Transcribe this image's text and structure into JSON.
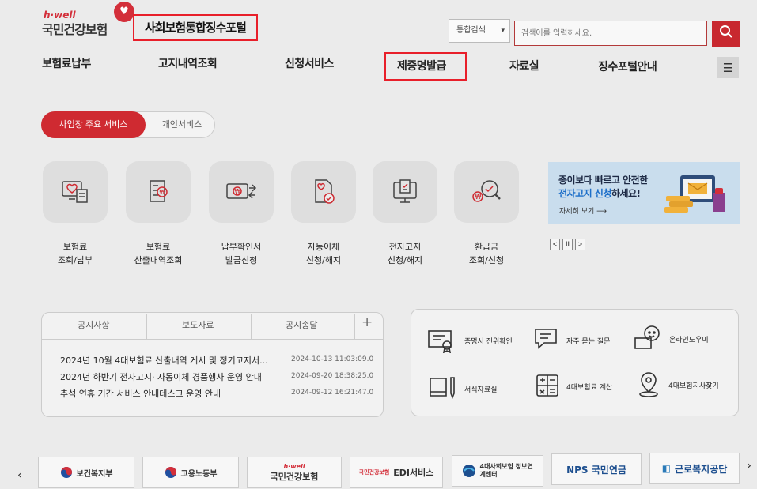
{
  "header": {
    "logo_hwell": "h·well",
    "logo_main": "국민건강보험",
    "portal_title": "사회보험통합징수포털",
    "search_scope": "통합검색",
    "search_placeholder": "검색어를 입력하세요."
  },
  "nav": {
    "items": [
      "보험료납부",
      "고지내역조회",
      "신청서비스",
      "제증명발급",
      "자료실",
      "징수포털안내"
    ],
    "highlighted": "제증명발급"
  },
  "tabs": {
    "active": "사업장 주요 서비스",
    "inactive": "개인서비스"
  },
  "services": [
    {
      "line1": "보험료",
      "line2": "조회/납부",
      "icon": "monitor-heart-icon"
    },
    {
      "line1": "보험료",
      "line2": "산출내역조회",
      "icon": "document-won-icon"
    },
    {
      "line1": "납부확인서",
      "line2": "발급신청",
      "icon": "bill-won-icon"
    },
    {
      "line1": "자동이체",
      "line2": "신청/해지",
      "icon": "document-check-icon"
    },
    {
      "line1": "전자고지",
      "line2": "신청/해지",
      "icon": "computer-notice-icon"
    },
    {
      "line1": "환급금",
      "line2": "조회/신청",
      "icon": "magnifier-refund-icon"
    }
  ],
  "banner": {
    "line1": "종이보다 빠르고 안전한",
    "line2_highlight": "전자고지 신청",
    "line2_rest": "하세요!",
    "more": "자세히 보기"
  },
  "pager": {
    "prev": "<",
    "pause": "II",
    "next": ">"
  },
  "notice": {
    "tabs": [
      "공지사항",
      "보도자료",
      "공시송달"
    ],
    "plus": "+",
    "items": [
      {
        "title": "2024년 10월 4대보험료 산출내역 게시 및 정기고지서...",
        "date": "2024-10-13 11:03:09.0"
      },
      {
        "title": "2024년 하반기 전자고지· 자동이체 경품행사 운영 안내",
        "date": "2024-09-20 18:38:25.0"
      },
      {
        "title": "추석 연휴 기간 서비스 안내데스크 운영 안내",
        "date": "2024-09-12 16:21:47.0"
      }
    ]
  },
  "quick_links": [
    {
      "label": "증명서 진위확인",
      "icon": "certificate-icon"
    },
    {
      "label": "자주 묻는 질문",
      "icon": "chat-bubble-icon"
    },
    {
      "label": "온라인도우미",
      "icon": "online-helper-icon"
    },
    {
      "label": "서식자료실",
      "icon": "book-pen-icon"
    },
    {
      "label": "4대보험료 계산",
      "icon": "calculator-icon"
    },
    {
      "label": "4대보험지사찾기",
      "icon": "location-pin-icon"
    }
  ],
  "footer": {
    "prev": "‹",
    "next": "›",
    "logos": [
      {
        "label": "보건복지부"
      },
      {
        "label": "고용노동부"
      },
      {
        "label": "국민건강보험",
        "small": "h·well"
      },
      {
        "label": "EDI서비스",
        "small": "국민건강보험"
      },
      {
        "label": "4대사회보험 정보연계센터"
      },
      {
        "label": "NPS 국민연금"
      },
      {
        "label": "근로복지공단"
      }
    ]
  },
  "colors": {
    "brand_red": "#cf2a31",
    "highlight_box": "#e81f2a",
    "banner_bg": "#c9dded",
    "banner_link": "#1d6fc9"
  }
}
